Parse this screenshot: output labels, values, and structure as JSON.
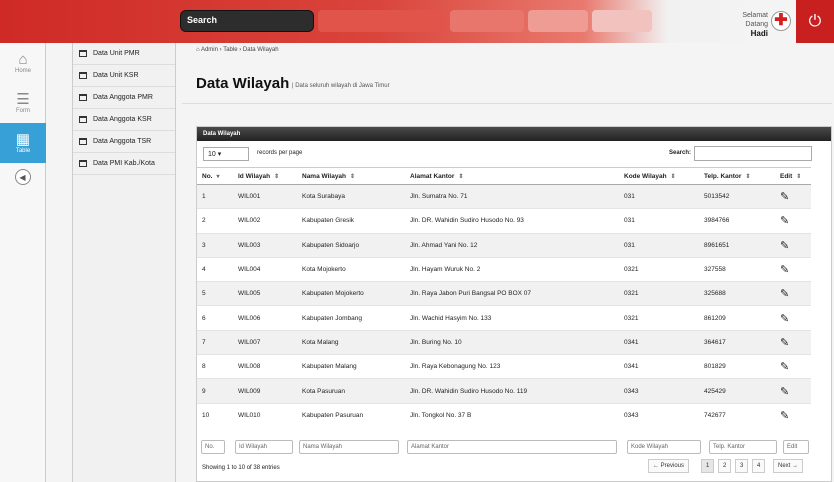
{
  "topbar": {
    "search_label": "Search",
    "welcome_line": "Selamat Datang",
    "user_name": "Hadi"
  },
  "sidebar": {
    "items": [
      {
        "label": "Home"
      },
      {
        "label": "Form"
      },
      {
        "label": "Table"
      }
    ]
  },
  "submenu": {
    "items": [
      "Data Unit PMR",
      "Data Unit KSR",
      "Data Anggota PMR",
      "Data Anggota KSR",
      "Data Anggota TSR",
      "Data PMI Kab./Kota"
    ]
  },
  "breadcrumb": {
    "admin": "Admin",
    "table": "Table",
    "current": "Data Wilayah",
    "sep": "›"
  },
  "page": {
    "title": "Data Wilayah",
    "subtitle": "| Data seluruh wilayah di Jawa Timur"
  },
  "panel": {
    "title": "Data Wilayah",
    "per_page": "10",
    "per_page_label": "records per page",
    "search_label": "Search:"
  },
  "table": {
    "headers": [
      "No.",
      "Id Wilayah",
      "Nama Wilayah",
      "Alamat Kantor",
      "Kode Wilayah",
      "Telp. Kantor",
      "Edit"
    ],
    "rows": [
      [
        "1",
        "WIL001",
        "Kota Surabaya",
        "Jln. Sumatra No. 71",
        "031",
        "5013542"
      ],
      [
        "2",
        "WIL002",
        "Kabupaten Gresik",
        "Jln. DR. Wahidin Sudiro Husodo No. 93",
        "031",
        "3984766"
      ],
      [
        "3",
        "WIL003",
        "Kabupaten Sidoarjo",
        "Jln. Ahmad Yani No. 12",
        "031",
        "8961651"
      ],
      [
        "4",
        "WIL004",
        "Kota Mojokerto",
        "Jln. Hayam Wuruk No. 2",
        "0321",
        "327558"
      ],
      [
        "5",
        "WIL005",
        "Kabupaten Mojokerto",
        "Jln. Raya Jabon Puri Bangsal PO BOX 07",
        "0321",
        "325688"
      ],
      [
        "6",
        "WIL006",
        "Kabupaten Jombang",
        "Jln. Wachid Hasyim No. 133",
        "0321",
        "861209"
      ],
      [
        "7",
        "WIL007",
        "Kota Malang",
        "Jln. Buring No. 10",
        "0341",
        "364617"
      ],
      [
        "8",
        "WIL008",
        "Kabupaten Malang",
        "Jln. Raya Kebonagung No. 123",
        "0341",
        "801829"
      ],
      [
        "9",
        "WIL009",
        "Kota Pasuruan",
        "Jln. DR. Wahidin Sudiro Husodo No. 119",
        "0343",
        "425429"
      ],
      [
        "10",
        "WIL010",
        "Kabupaten Pasuruan",
        "Jln. Tongkol No. 37 B",
        "0343",
        "742677"
      ]
    ],
    "filters": [
      "No.",
      "Id Wilayah",
      "Nama Wilayah",
      "Alamat Kantor",
      "Kode Wilayah",
      "Telp. Kantor",
      "Edit"
    ]
  },
  "footer": {
    "info": "Showing 1 to 10 of 38 entries",
    "prev": "← Previous",
    "pages": [
      "1",
      "2",
      "3",
      "4"
    ],
    "next": "Next →"
  },
  "colors": {
    "red": "#cf2a26",
    "active_blue": "#37a0d6"
  }
}
